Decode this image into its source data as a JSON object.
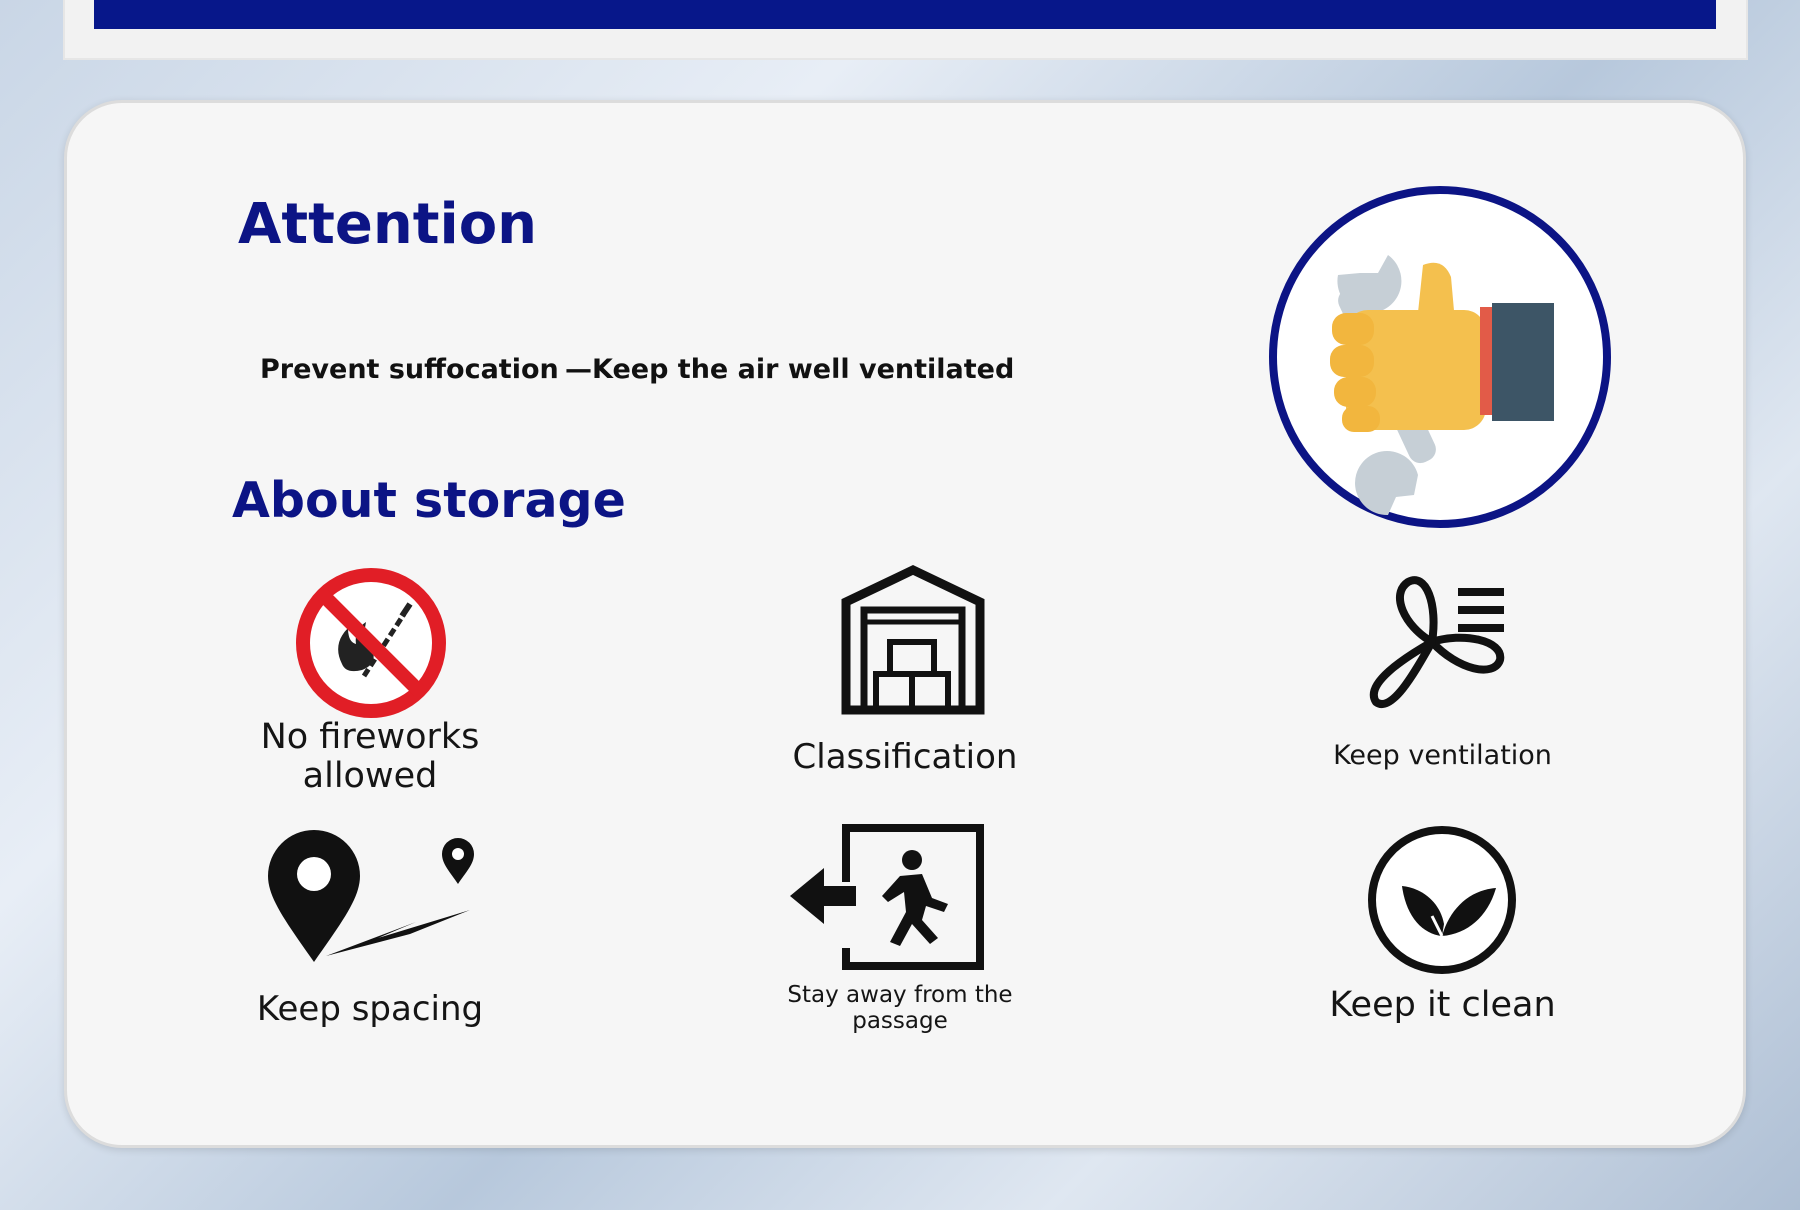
{
  "attention": {
    "title": "Attention",
    "line_left": "Prevent suffocation",
    "line_right": "—Keep the air well ventilated"
  },
  "storage": {
    "title": "About storage",
    "items": [
      {
        "label": "No fireworks allowed",
        "icon": "no-fire-icon"
      },
      {
        "label": "Classification",
        "icon": "warehouse-icon"
      },
      {
        "label": "Keep ventilation",
        "icon": "fan-icon"
      },
      {
        "label": "Keep spacing",
        "icon": "map-pin-distance-icon"
      },
      {
        "label": "Stay away from the passage",
        "icon": "exit-icon"
      },
      {
        "label": "Keep it clean",
        "icon": "leaf-icon"
      }
    ]
  },
  "colors": {
    "accent": "#07178a",
    "prohibition": "#e11e26",
    "thumb": "#f4c04e",
    "sleeve": "#3d5566"
  }
}
